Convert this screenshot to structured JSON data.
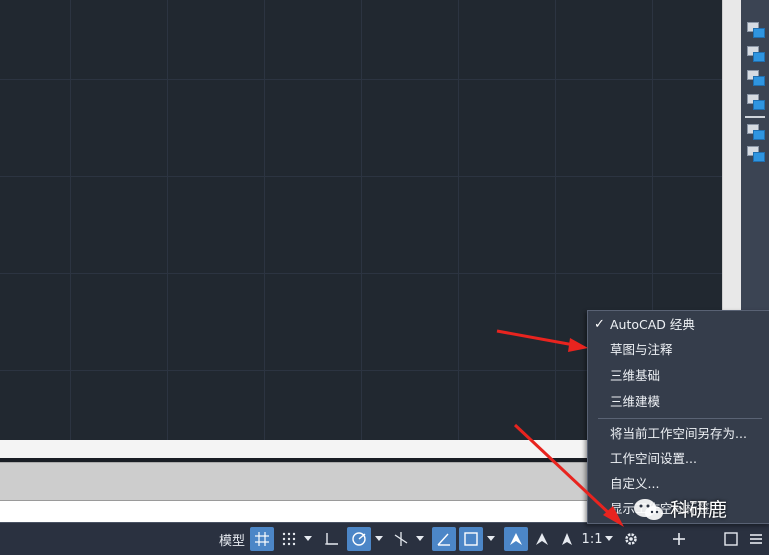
{
  "statusbar": {
    "model_label": "模型",
    "scale_label": "1:1"
  },
  "workspace_menu": {
    "items": [
      {
        "label": "AutoCAD 经典",
        "checked": true
      },
      {
        "label": "草图与注释",
        "checked": false
      },
      {
        "label": "三维基础",
        "checked": false
      },
      {
        "label": "三维建模",
        "checked": false
      },
      {
        "label": "将当前工作空间另存为...",
        "checked": false
      },
      {
        "label": "工作空间设置...",
        "checked": false
      },
      {
        "label": "自定义...",
        "checked": false
      },
      {
        "label": "显示工作空间标签",
        "checked": false
      }
    ],
    "check_glyph": "✓"
  },
  "annotations": {
    "arrow_color": "#e8241f"
  },
  "watermark": {
    "text": "科研鹿"
  },
  "colors": {
    "canvas_bg": "#212830",
    "grid_line": "#2c3441",
    "statusbar_bg": "#2a3140",
    "active_button": "#4c86c7",
    "menu_bg": "#353d4b"
  }
}
